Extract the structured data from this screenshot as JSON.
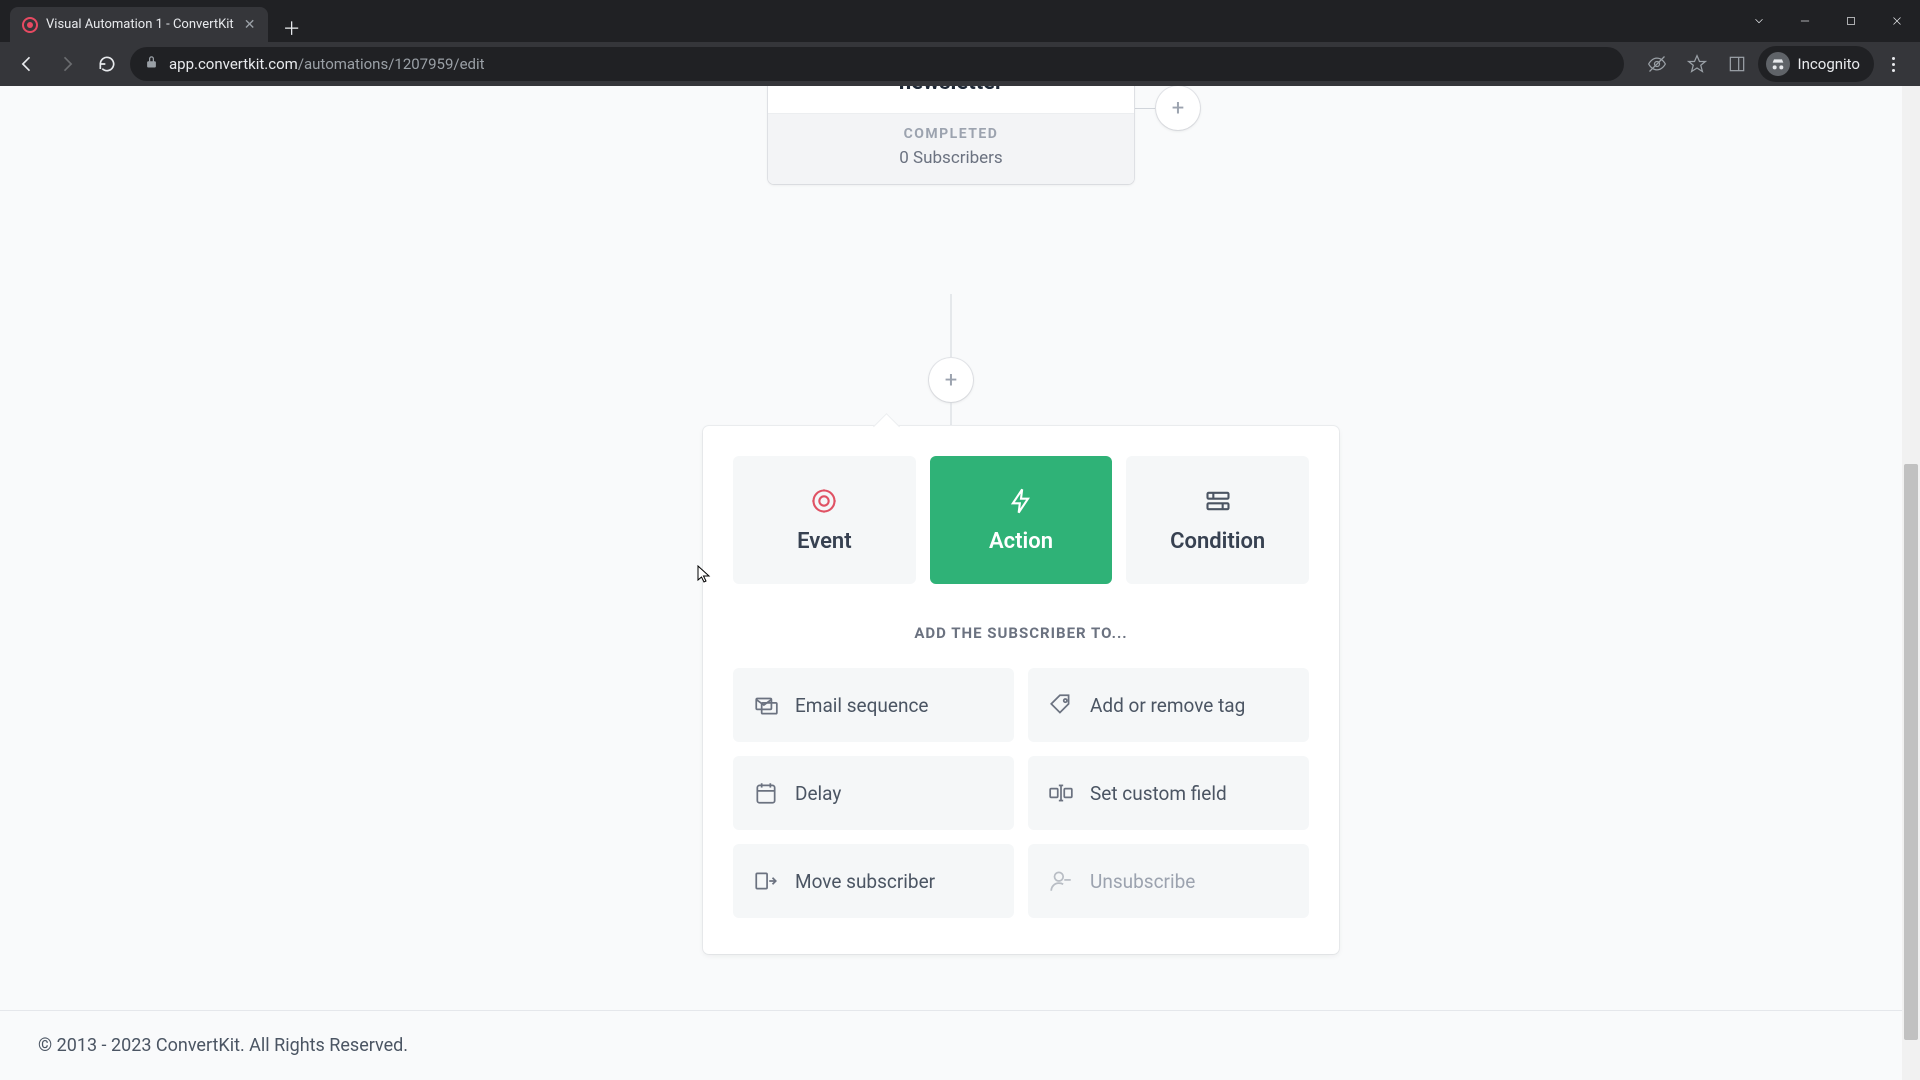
{
  "browser": {
    "tab_title": "Visual Automation 1 - ConvertKit",
    "url_host": "app.convertkit.com",
    "url_path": "/automations/1207959/edit",
    "incognito_label": "Incognito"
  },
  "node": {
    "title": "newsletter",
    "status": "COMPLETED",
    "subscribers": "0 Subscribers"
  },
  "picker": {
    "types": {
      "event": "Event",
      "action": "Action",
      "condition": "Condition"
    },
    "heading": "ADD THE SUBSCRIBER TO...",
    "options": {
      "email_sequence": "Email sequence",
      "add_remove_tag": "Add or remove tag",
      "delay": "Delay",
      "set_custom_field": "Set custom field",
      "move_subscriber": "Move subscriber",
      "unsubscribe": "Unsubscribe"
    }
  },
  "footer": "© 2013 - 2023 ConvertKit. All Rights Reserved."
}
